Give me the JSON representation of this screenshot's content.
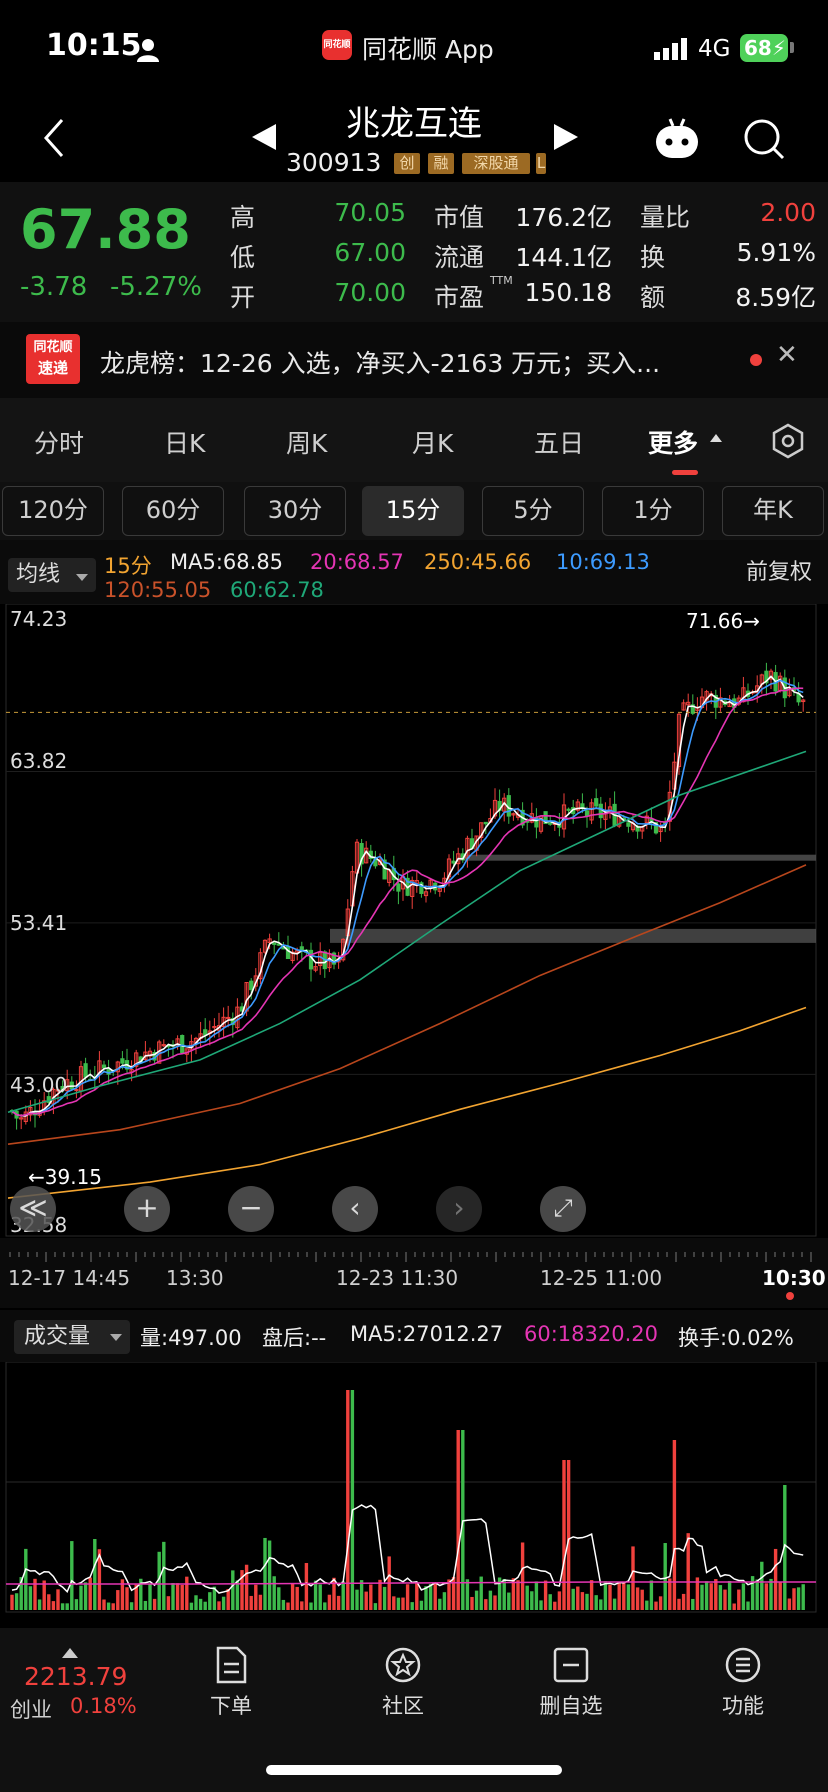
{
  "status_bar": {
    "time": "10:15",
    "app_name": "同花顺 App",
    "app_badge": "同花顺",
    "network": "4G",
    "battery": "68"
  },
  "header": {
    "stock_name": "兆龙互连",
    "stock_code": "300913",
    "tags": [
      "创",
      "融",
      "深股通",
      "L"
    ]
  },
  "quote": {
    "price": "67.88",
    "change": "-3.78",
    "change_pct": "-5.27%",
    "rows": [
      {
        "l1": "高",
        "v1": "70.05",
        "l2": "市值",
        "v2": "176.2亿",
        "l3": "量比",
        "v3": "2.00"
      },
      {
        "l1": "低",
        "v1": "67.00",
        "l2": "流通",
        "v2": "144.1亿",
        "l3": "换",
        "v3": "5.91%"
      },
      {
        "l1": "开",
        "v1": "70.00",
        "l2": "市盈",
        "v2": "150.18",
        "l3": "额",
        "v3": "8.59亿"
      }
    ],
    "ttm": "TTM"
  },
  "news": {
    "logo_top": "同花顺",
    "logo_bottom": "速递",
    "text": "龙虎榜：12-26 入选，净买入-2163 万元；买入..."
  },
  "tabs": [
    "分时",
    "日K",
    "周K",
    "月K",
    "五日",
    "更多"
  ],
  "periods": [
    "120分",
    "60分",
    "30分",
    "15分",
    "5分",
    "1分",
    "年K"
  ],
  "ma_bar": {
    "type": "均线",
    "period": "15分",
    "ma5": "MA5:68.85",
    "ma20": "20:68.57",
    "ma250": "250:45.66",
    "ma10": "10:69.13",
    "ma120": "120:55.05",
    "ma60": "60:62.78",
    "adjust": "前复权"
  },
  "colors": {
    "up": "#f0413d",
    "down": "#3dbb4c",
    "ma5": "#ffffff",
    "ma10": "#3d9bff",
    "ma20": "#e535b4",
    "ma60": "#1fa878",
    "ma120": "#b8461c",
    "ma250": "#f2a431"
  },
  "kline": {
    "y_labels": [
      "74.23",
      "63.82",
      "53.41",
      "43.00",
      "32.58"
    ],
    "high_marker": "71.66→",
    "low_marker": "←39.15",
    "time_labels": [
      "12-17 14:45",
      "13:30",
      "12-23 11:30",
      "12-25 11:00",
      "10:30"
    ],
    "controls": [
      "≪",
      "+",
      "−",
      "‹",
      "›",
      "⤢"
    ]
  },
  "volume": {
    "type": "成交量",
    "vol": "量:497.00",
    "after": "盘后:--",
    "ma5": "MA5:27012.27",
    "ma60": "60:18320.20",
    "turnover": "换手:0.02%"
  },
  "bottom_nav": {
    "index_value": "2213.79",
    "index_name": "创业",
    "index_pct": "0.18%",
    "items": [
      "下单",
      "社区",
      "删自选",
      "功能"
    ]
  }
}
